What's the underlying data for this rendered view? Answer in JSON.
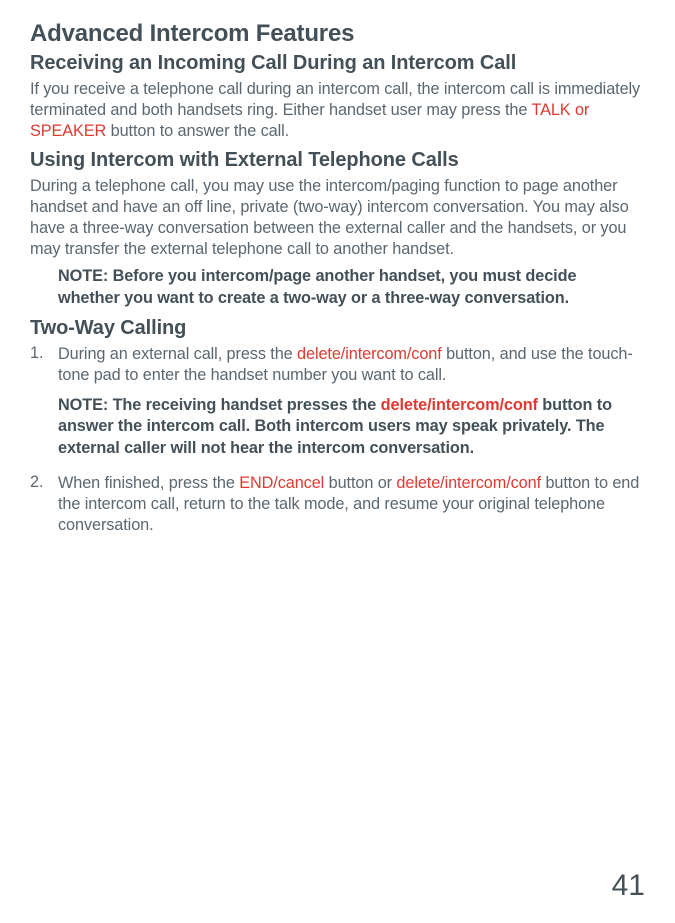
{
  "title": "Advanced Intercom Features",
  "section1": {
    "heading": "Receiving an Incoming Call During an Intercom Call",
    "para_pre": "If you receive a telephone call during an intercom call, the intercom call is immediately terminated and both handsets ring. Either handset user may press the ",
    "para_red": "TALK or SPEAKER",
    "para_post": " button to answer the call."
  },
  "section2": {
    "heading": "Using Intercom with External Telephone Calls",
    "para": "During a telephone call, you may use the intercom/paging function to page another handset and have an off line, private (two-way) intercom conversation. You may also have a three-way conversation between the external caller and the handsets, or you may transfer the external telephone call to another handset.",
    "note": "NOTE: Before you intercom/page another handset, you must decide whether you want to create a two-way or a three-way conversation."
  },
  "section3": {
    "heading": "Two-Way Calling",
    "item1": {
      "num": "1.",
      "text_pre": "During an external call, press the ",
      "text_red": "delete/intercom/conf",
      "text_post": " button, and use the touch-tone pad to enter the handset number you want to call.",
      "note_pre": "NOTE: The receiving handset presses the ",
      "note_red": "delete/intercom/conf",
      "note_post": " button to answer the intercom call. Both intercom users may speak privately. The external caller will not hear the intercom conversation."
    },
    "item2": {
      "num": "2.",
      "text_pre": "When finished, press the ",
      "text_red1": "END/cancel",
      "text_mid": " button or ",
      "text_red2": "delete/intercom/conf",
      "text_post": " button to end the intercom call, return to the talk mode, and resume your original telephone conversation."
    }
  },
  "page_number": "41"
}
